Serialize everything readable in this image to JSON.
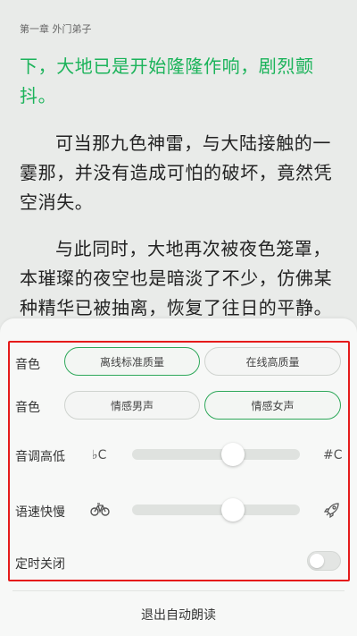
{
  "reader": {
    "chapter_title": "第一章 外门弟子",
    "highlight_text": "下，大地已是开始隆隆作响，剧烈颤抖。",
    "paragraph2": "可当那九色神雷，与大陆接触的一霎那，并没有造成可怕的破坏，竟然凭空消失。",
    "paragraph3": "与此同时，大地再次被夜色笼罩，本璀璨的夜空也是暗淡了不少，仿佛某种精华已被抽离，恢复了往日的平静。"
  },
  "settings": {
    "voice_quality": {
      "label": "音色",
      "options": [
        "离线标准质量",
        "在线高质量"
      ],
      "selected": "离线标准质量"
    },
    "voice_type": {
      "label": "音色",
      "options": [
        "情感男声",
        "情感女声"
      ],
      "selected": "情感女声"
    },
    "pitch": {
      "label": "音调高低",
      "low_icon": "♭C",
      "high_icon": "#C",
      "value_fraction": 0.49
    },
    "speed": {
      "label": "语速快慢",
      "low_icon": "bicycle-icon",
      "high_icon": "rocket-icon",
      "value_fraction": 0.49
    },
    "timer": {
      "label": "定时关闭",
      "enabled": false
    }
  },
  "footer": {
    "exit_label": "退出自动朗读"
  },
  "colors": {
    "accent_green": "#1bb35a",
    "highlight_frame": "#e51b1b"
  }
}
